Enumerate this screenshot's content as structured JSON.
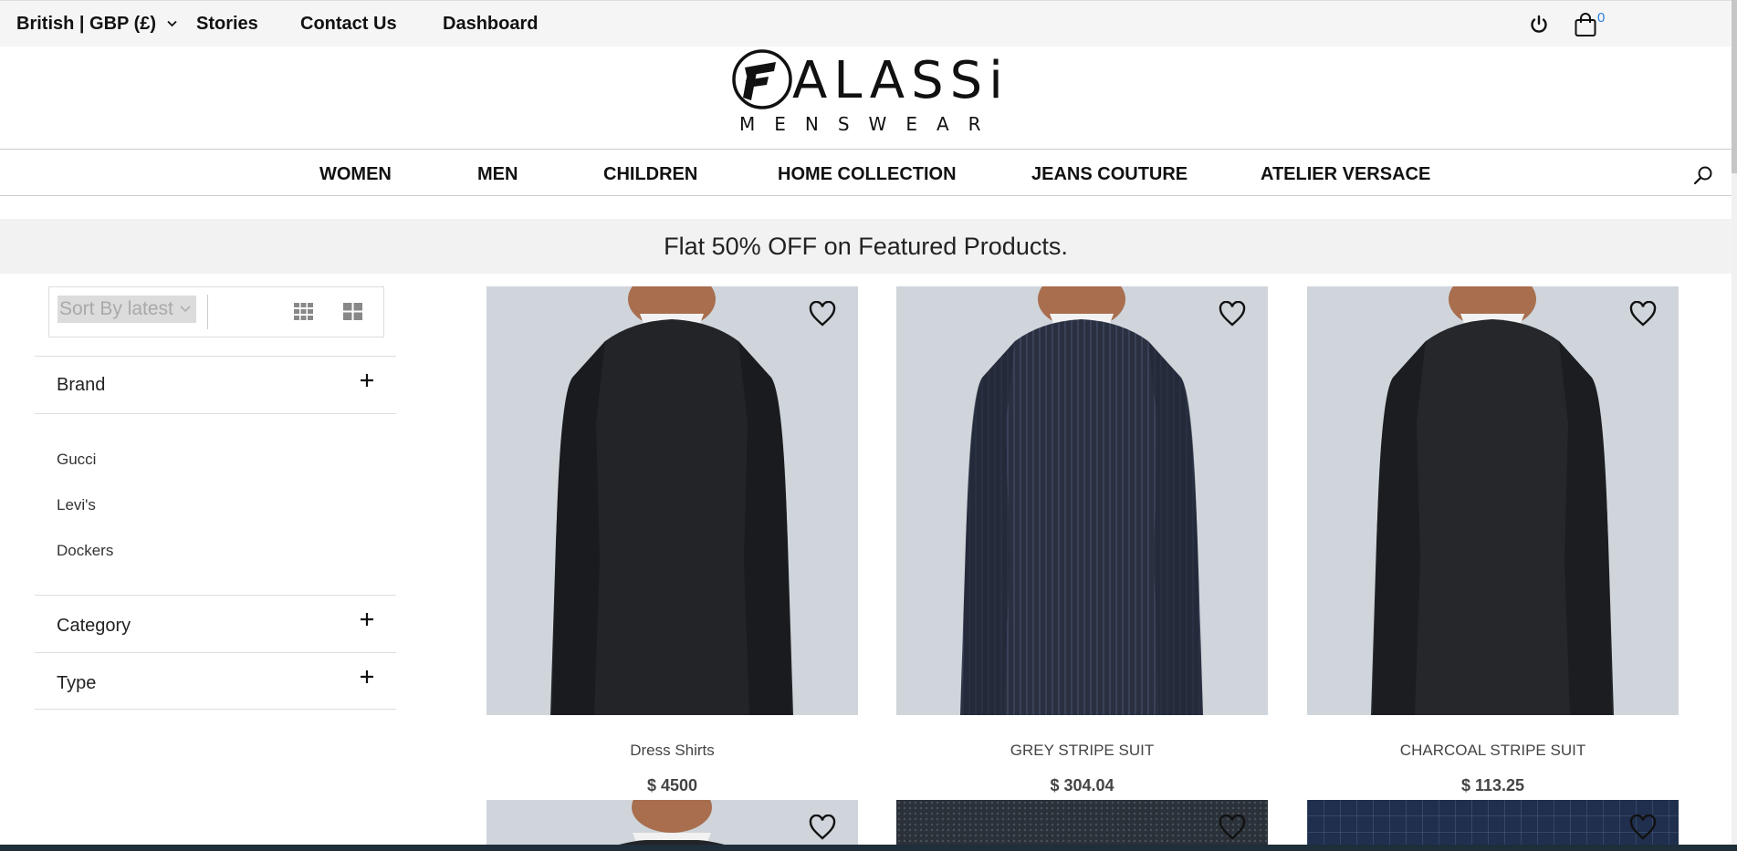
{
  "topbar": {
    "locale_label": "British | GBP (£)",
    "links": [
      "Stories",
      "Contact Us",
      "Dashboard"
    ],
    "cart_count": "0"
  },
  "logo": {
    "wordmark": "ALASSi",
    "subtitle": "MENSWEAR"
  },
  "nav": {
    "items": [
      "WOMEN",
      "MEN",
      "CHILDREN",
      "HOME COLLECTION",
      "JEANS COUTURE",
      "ATELIER VERSACE"
    ]
  },
  "promo": {
    "text": "Flat 50% OFF on Featured Products."
  },
  "toolbar": {
    "sort_label": "Sort By latest"
  },
  "filters": {
    "brand_title": "Brand",
    "brands": [
      "Gucci",
      "Levi's",
      "Dockers"
    ],
    "category_title": "Category",
    "type_title": "Type"
  },
  "products": [
    {
      "name": "Dress Shirts",
      "price": "$ 4500"
    },
    {
      "name": "GREY STRIPE SUIT",
      "price": "$ 304.04"
    },
    {
      "name": "CHARCOAL STRIPE SUIT",
      "price": "$ 113.25"
    }
  ],
  "colors": {
    "accent": "#2a7de1",
    "banner_bg": "#f1f2f1",
    "image_bg": "#cfd5db"
  },
  "icons": [
    "chevron-down-icon",
    "power-icon",
    "cart-icon",
    "search-icon",
    "grid-three-icon",
    "grid-two-icon",
    "plus-icon",
    "heart-icon"
  ]
}
